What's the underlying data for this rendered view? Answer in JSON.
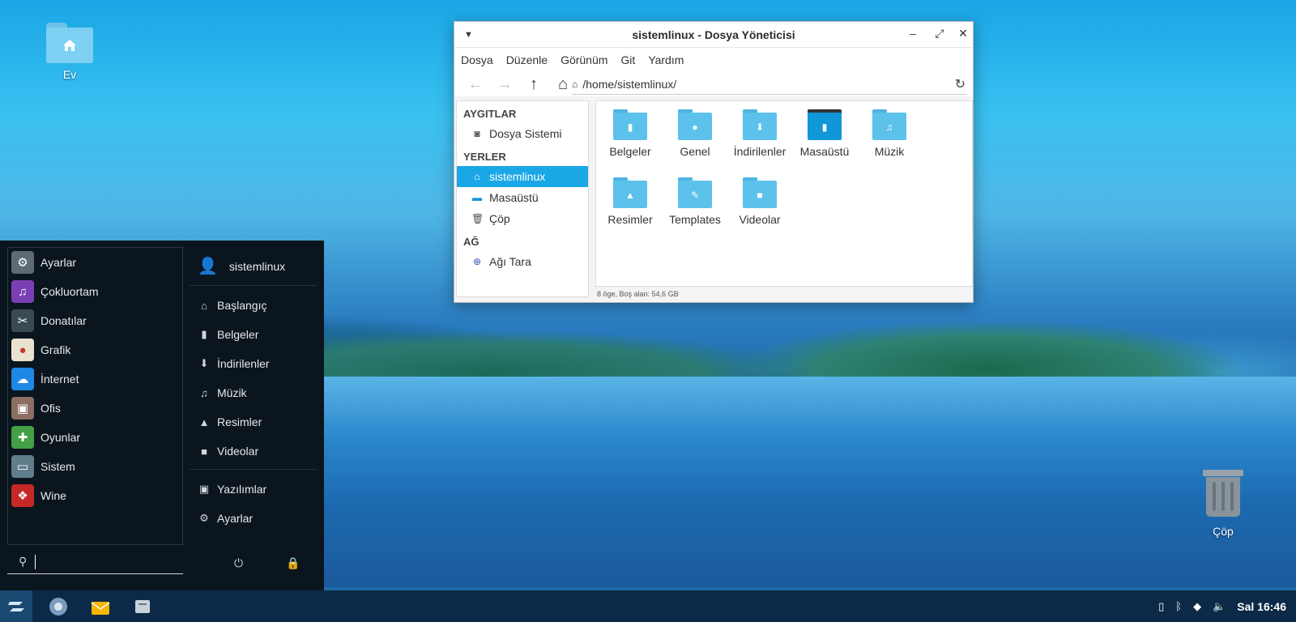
{
  "desktop": {
    "home_label": "Ev",
    "trash_label": "Çöp"
  },
  "window": {
    "title": "sistemlinux - Dosya Yöneticisi",
    "menu": [
      "Dosya",
      "Düzenle",
      "Görünüm",
      "Git",
      "Yardım"
    ],
    "address": "/home/sistemlinux/",
    "sidebar": {
      "devices_header": "AYGITLAR",
      "devices": [
        "Dosya Sistemi"
      ],
      "places_header": "YERLER",
      "places": [
        "sistemlinux",
        "Masaüstü",
        "Çöp"
      ],
      "network_header": "AĞ",
      "network": [
        "Ağı Tara"
      ]
    },
    "files": [
      {
        "name": "Belgeler",
        "icon": "document-icon"
      },
      {
        "name": "Genel",
        "icon": "user-icon"
      },
      {
        "name": "İndirilenler",
        "icon": "download-icon"
      },
      {
        "name": "Masaüstü",
        "icon": "desktop-icon"
      },
      {
        "name": "Müzik",
        "icon": "music-icon"
      },
      {
        "name": "Resimler",
        "icon": "image-icon"
      },
      {
        "name": "Templates",
        "icon": "template-icon"
      },
      {
        "name": "Videolar",
        "icon": "video-icon"
      }
    ],
    "status": "8 öge, Boş alan: 54,6 GB"
  },
  "menu": {
    "categories": [
      "Ayarlar",
      "Çokluortam",
      "Donatılar",
      "Grafik",
      "İnternet",
      "Ofis",
      "Oyunlar",
      "Sistem",
      "Wine"
    ],
    "category_colors": [
      "#5d6b77",
      "#7b3fb5",
      "#3a4a55",
      "#e9e2cf",
      "#1e88e5",
      "#8d6e63",
      "#43a047",
      "#607d8b",
      "#c62828"
    ],
    "user": "sistemlinux",
    "places": [
      "Başlangıç",
      "Belgeler",
      "İndirilenler",
      "Müzik",
      "Resimler",
      "Videolar"
    ],
    "bottom": [
      "Yazılımlar",
      "Ayarlar"
    ]
  },
  "taskbar": {
    "clock": "Sal 16:46"
  }
}
